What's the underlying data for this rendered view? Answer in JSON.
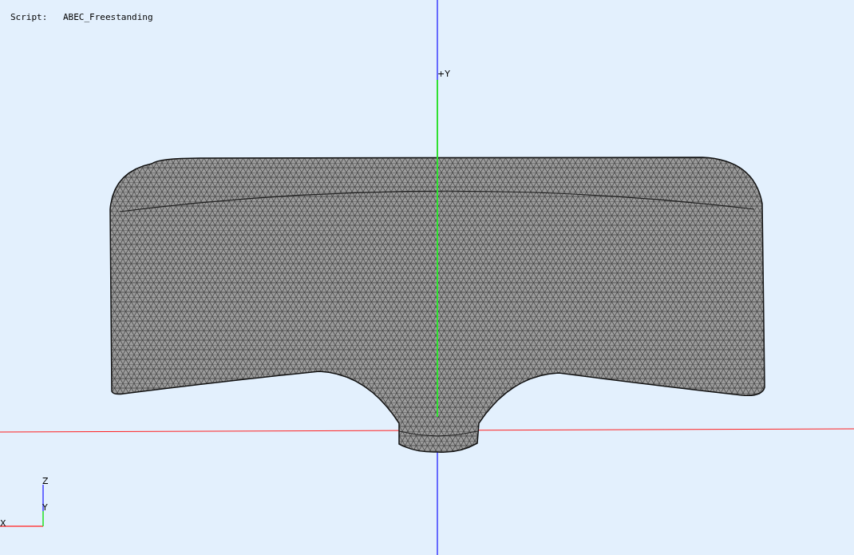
{
  "script": {
    "label": "Script:",
    "value": "ABEC_Freestanding"
  },
  "view_axes": {
    "plus_y": "+Y"
  },
  "gizmo": {
    "z": "Z",
    "y": "Y",
    "x": "X"
  }
}
